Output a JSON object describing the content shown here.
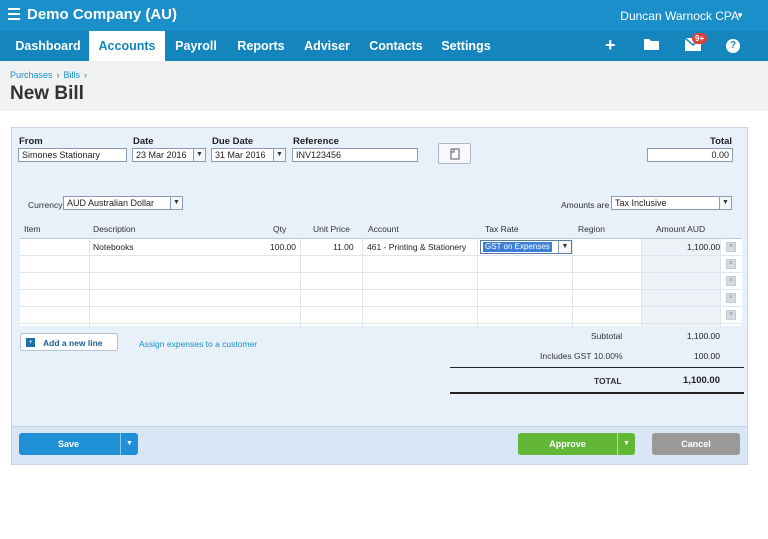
{
  "topbar": {
    "company": "Demo Company (AU)",
    "user": "Duncan Warnock CPA"
  },
  "nav": {
    "tabs": [
      "Dashboard",
      "Accounts",
      "Payroll",
      "Reports",
      "Adviser",
      "Contacts",
      "Settings"
    ],
    "active": "Accounts",
    "badge": "9+"
  },
  "breadcrumb": {
    "items": [
      "Purchases",
      "Bills"
    ]
  },
  "page": {
    "title": "New Bill"
  },
  "form": {
    "from_label": "From",
    "from_value": "Simones Stationary",
    "date_label": "Date",
    "date_value": "23 Mar 2016",
    "due_label": "Due Date",
    "due_value": "31 Mar 2016",
    "reference_label": "Reference",
    "reference_value": "INV123456",
    "total_label": "Total",
    "total_value": "0.00",
    "currency_label": "Currency",
    "currency_value": "AUD Australian Dollar",
    "amounts_label": "Amounts are",
    "amounts_value": "Tax Inclusive"
  },
  "table": {
    "headers": [
      "Item",
      "Description",
      "Qty",
      "Unit Price",
      "Account",
      "Tax Rate",
      "Region",
      "Amount AUD"
    ],
    "rows": [
      {
        "item": "",
        "description": "Notebooks",
        "qty": "100.00",
        "unit_price": "11.00",
        "account": "461 - Printing & Stationery",
        "tax_rate": "GST on Expenses",
        "region": "",
        "amount": "1,100.00"
      }
    ]
  },
  "actions": {
    "add_line": "Add a new line",
    "assign": "Assign expenses to a customer"
  },
  "totals": {
    "subtotal_label": "Subtotal",
    "subtotal_value": "1,100.00",
    "gst_label": "Includes GST 10.00%",
    "gst_value": "100.00",
    "total_label": "TOTAL",
    "total_value": "1,100.00"
  },
  "footer": {
    "save": "Save",
    "approve": "Approve",
    "cancel": "Cancel"
  },
  "colors": {
    "brand": "#1a8fc9",
    "approve": "#62b836",
    "cancel": "#9a9a9a"
  }
}
